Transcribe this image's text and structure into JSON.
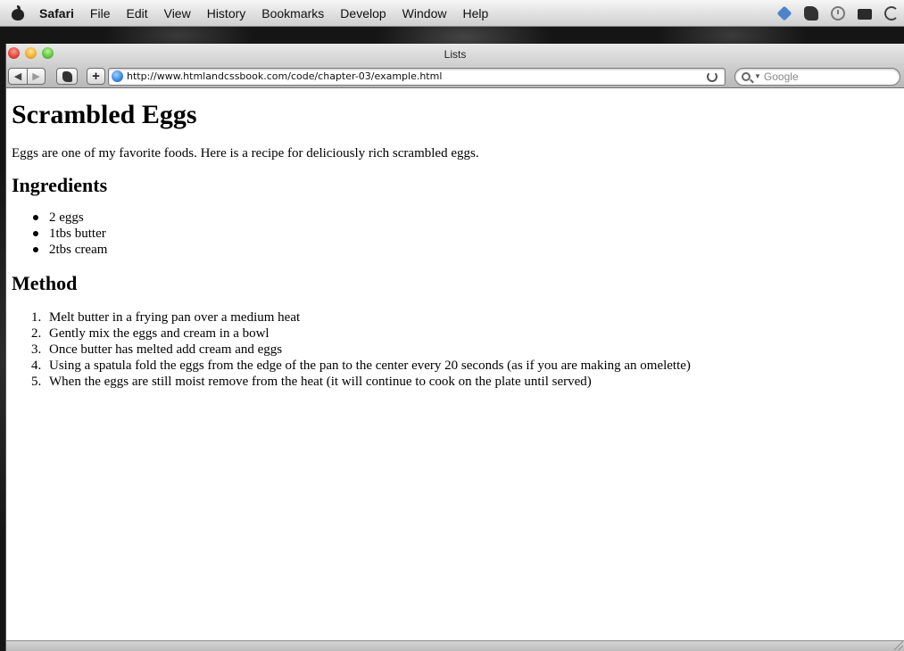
{
  "menubar": {
    "app_name": "Safari",
    "items": [
      "File",
      "Edit",
      "View",
      "History",
      "Bookmarks",
      "Develop",
      "Window",
      "Help"
    ]
  },
  "window": {
    "title": "Lists"
  },
  "toolbar": {
    "url": "http://www.htmlandcssbook.com/code/chapter-03/example.html",
    "search_placeholder": "Google",
    "add_label": "+",
    "back_glyph": "◀",
    "forward_glyph": "▶"
  },
  "page": {
    "heading": "Scrambled Eggs",
    "intro": "Eggs are one of my favorite foods. Here is a recipe for deliciously rich scrambled eggs.",
    "ingredients_heading": "Ingredients",
    "ingredients": [
      "2 eggs",
      "1tbs butter",
      "2tbs cream"
    ],
    "method_heading": "Method",
    "method_numbers": [
      "1.",
      "2.",
      "3.",
      "4.",
      "5."
    ],
    "method": [
      "Melt butter in a frying pan over a medium heat",
      "Gently mix the eggs and cream in a bowl",
      "Once butter has melted add cream and eggs",
      "Using a spatula fold the eggs from the edge of the pan to the center every 20 seconds (as if you are making an omelette)",
      "When the eggs are still moist remove from the heat (it will continue to cook on the plate until served)"
    ]
  },
  "icons": {
    "apple": "apple-logo-icon",
    "tray": [
      "dropbox-icon",
      "evernote-icon",
      "time-machine-icon",
      "display-icon",
      "sync-icon"
    ],
    "globe": "globe-icon",
    "reload": "reload-icon",
    "search": "search-icon"
  },
  "colors": {
    "close": "#e0443a",
    "minimize": "#f1ae2d",
    "maximize": "#5fc33d",
    "globe": "#2a78d6"
  }
}
